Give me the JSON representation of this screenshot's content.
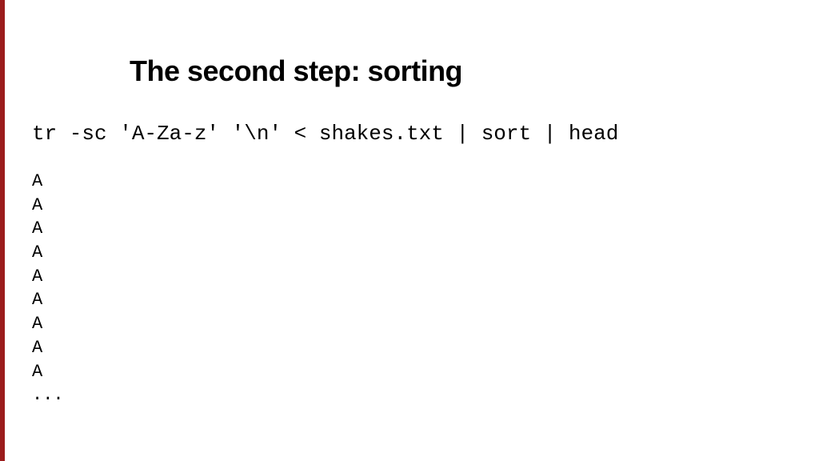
{
  "slide": {
    "accent_color": "#9b1c1c",
    "title": "The second step: sorting",
    "command": "tr -sc 'A-Za-z' '\\n' < shakes.txt | sort | head",
    "output_lines": [
      "A",
      "A",
      "A",
      "A",
      "A",
      "A",
      "A",
      "A",
      "A",
      "..."
    ]
  }
}
